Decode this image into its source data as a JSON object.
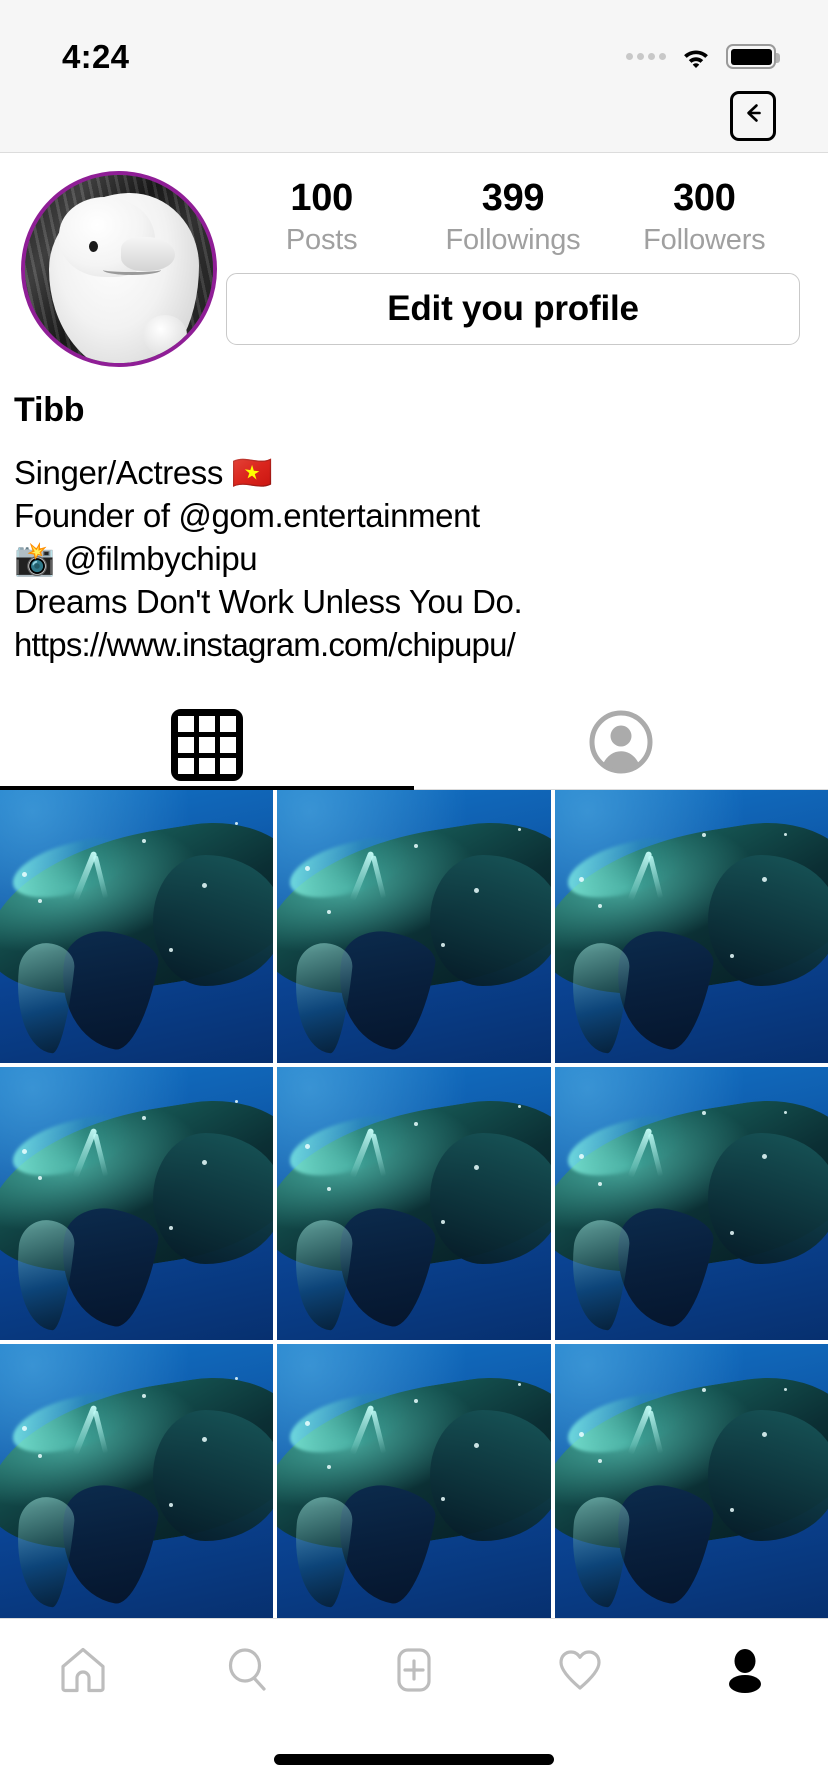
{
  "status_bar": {
    "time": "4:24",
    "icons": [
      "signal-dots-icon",
      "wifi-icon",
      "battery-icon"
    ]
  },
  "nav": {
    "back_icon": "back-arrow-icon"
  },
  "profile": {
    "avatar_alt": "beluga-whale-statue-avatar",
    "avatar_ring_color": "#8f1e96",
    "stats": [
      {
        "value": "100",
        "label": "Posts"
      },
      {
        "value": "399",
        "label": "Followings"
      },
      {
        "value": "300",
        "label": "Followers"
      }
    ],
    "edit_button_label": "Edit you profile",
    "name": "Tibb",
    "bio_lines": [
      "Singer/Actress 🇻🇳",
      "Founder of @gom.entertainment",
      "📸 @filmbychipu",
      "Dreams Don't Work Unless You Do."
    ],
    "website": "https://www.instagram.com/chipupu/"
  },
  "tabs": [
    {
      "name": "grid",
      "icon": "grid-icon",
      "active": true
    },
    {
      "name": "tagged",
      "icon": "person-circle-icon",
      "active": false
    }
  ],
  "photo_grid": {
    "alt": "humpback-whale-underwater",
    "count": 9,
    "columns": 3
  },
  "bottom_nav": [
    {
      "name": "home",
      "icon": "home-icon",
      "active": false
    },
    {
      "name": "search",
      "icon": "search-icon",
      "active": false
    },
    {
      "name": "create",
      "icon": "plus-square-icon",
      "active": false
    },
    {
      "name": "activity",
      "icon": "heart-icon",
      "active": false
    },
    {
      "name": "profile",
      "icon": "person-filled-icon",
      "active": true
    }
  ],
  "colors": {
    "accent": "#8f1e96",
    "active": "#000000",
    "inactive": "#b0b0b0",
    "muted_text": "#a0a0a0",
    "border": "#dbdbdb",
    "photo_blue": "#0a4596"
  }
}
